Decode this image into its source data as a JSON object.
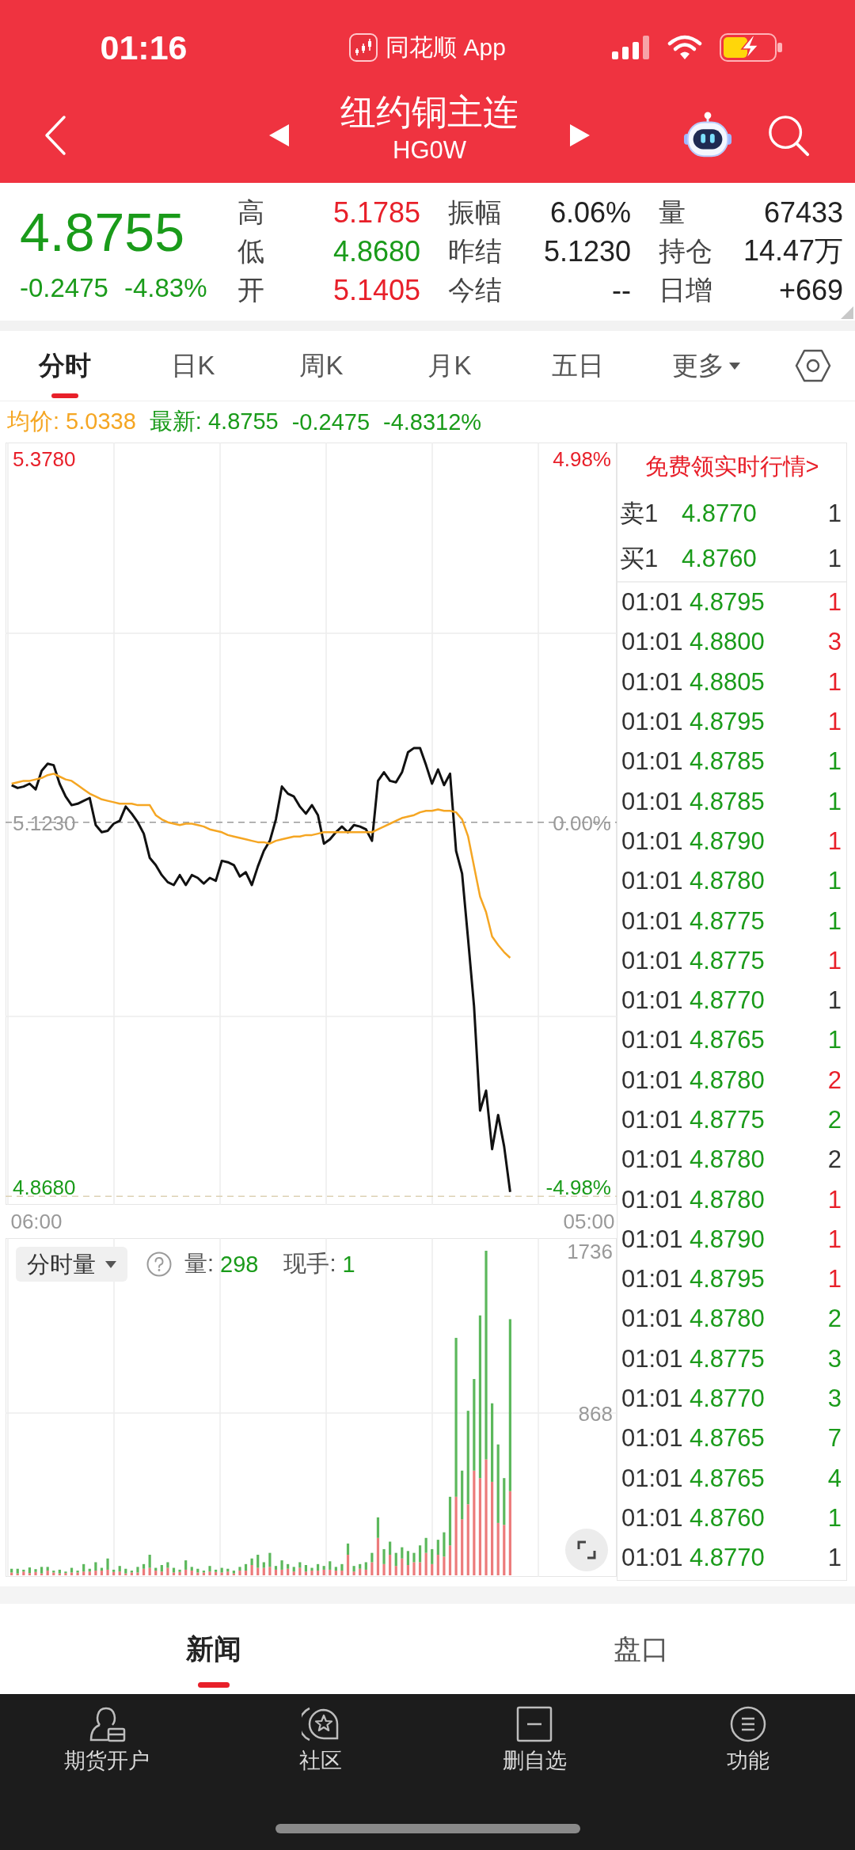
{
  "status_bar": {
    "time": "01:16",
    "app": "同花顺 App"
  },
  "header": {
    "title": "纽约铜主连",
    "code": "HG0W"
  },
  "quote": {
    "price": "4.8755",
    "change": "-0.2475",
    "change_percent": "-4.83%",
    "stats": [
      {
        "label": "高",
        "value": "5.1785",
        "color": "#e8202a"
      },
      {
        "label": "振幅",
        "value": "6.06%",
        "color": "#222222"
      },
      {
        "label": "量",
        "value": "67433",
        "color": "#222222"
      },
      {
        "label": "低",
        "value": "4.8680",
        "color": "#1a9b1a"
      },
      {
        "label": "昨结",
        "value": "5.1230",
        "color": "#222222"
      },
      {
        "label": "持仓",
        "value": "14.47万",
        "color": "#222222"
      },
      {
        "label": "开",
        "value": "5.1405",
        "color": "#e8202a"
      },
      {
        "label": "今结",
        "value": "--",
        "color": "#222222"
      },
      {
        "label": "日增",
        "value": "+669",
        "color": "#222222"
      }
    ]
  },
  "chart_tabs": [
    {
      "label": "分时",
      "selected": true,
      "kind": "tab"
    },
    {
      "label": "日K",
      "selected": false,
      "kind": "tab"
    },
    {
      "label": "周K",
      "selected": false,
      "kind": "tab"
    },
    {
      "label": "月K",
      "selected": false,
      "kind": "tab"
    },
    {
      "label": "五日",
      "selected": false,
      "kind": "tab"
    },
    {
      "label": "更多",
      "selected": false,
      "kind": "dropdown"
    }
  ],
  "info_line": {
    "average": "均价: 5.0338",
    "latest": "最新: 4.8755",
    "change": "-0.2475",
    "change_percent": "-4.8312%"
  },
  "price_chart": {
    "right_labels": [
      "4.98%",
      "0.00%",
      "-4.98%"
    ],
    "chart_data": {
      "type": "line",
      "categories": [
        null,
        null,
        null,
        null,
        "06:00",
        null,
        null,
        null,
        null,
        null,
        null,
        null,
        null,
        null,
        null,
        null,
        null,
        null,
        null,
        null,
        null,
        null,
        null,
        null,
        null,
        null,
        null,
        null,
        null,
        null,
        null,
        null,
        null,
        null,
        null,
        null,
        null,
        null,
        null,
        null,
        null,
        null,
        null,
        null,
        null,
        null,
        null,
        null,
        null,
        null,
        null,
        null,
        null,
        null,
        null,
        null,
        null,
        null,
        null,
        null,
        null,
        null,
        null,
        null,
        null,
        null,
        null,
        null,
        null,
        null,
        null,
        null,
        null,
        null,
        null,
        null,
        null,
        null,
        null,
        null,
        null,
        null,
        null,
        null,
        null,
        null,
        null,
        null,
        null,
        null,
        null,
        null,
        null,
        null,
        null,
        null,
        "05:00"
      ],
      "ylim": [
        4.855,
        5.389
      ],
      "yticks": [
        {
          "value": 5.378,
          "label": "5.3780"
        },
        {
          "value": 5.123,
          "label": "5.1230"
        },
        {
          "value": 4.868,
          "label": "4.8680"
        }
      ],
      "ref_lines": [
        {
          "axis": "y",
          "value": 5.123
        },
        {
          "axis": "y",
          "value": 4.861
        }
      ],
      "series": [
        {
          "color": "#111111",
          "values": [
            5.149,
            5.147,
            5.148,
            5.15,
            5.146,
            5.159,
            5.164,
            5.163,
            5.15,
            5.141,
            5.135,
            5.136,
            5.138,
            5.14,
            5.121,
            5.116,
            5.117,
            5.122,
            5.124,
            5.134,
            5.129,
            5.123,
            5.115,
            5.098,
            5.093,
            5.086,
            5.081,
            5.079,
            5.086,
            5.079,
            5.086,
            5.084,
            5.08,
            5.084,
            5.082,
            5.096,
            5.095,
            5.093,
            5.085,
            5.088,
            5.079,
            5.092,
            5.103,
            5.11,
            5.125,
            5.148,
            5.143,
            5.141,
            5.134,
            5.129,
            5.135,
            5.128,
            5.108,
            5.111,
            5.116,
            5.12,
            5.116,
            5.121,
            5.12,
            5.118,
            5.11,
            5.152,
            5.158,
            5.152,
            5.151,
            5.158,
            5.172,
            5.175,
            5.175,
            5.163,
            5.15,
            5.16,
            5.149,
            5.157,
            5.103,
            5.087,
            5.041,
            4.994,
            4.921,
            4.935,
            4.894,
            4.918,
            4.896,
            4.864,
            null,
            null,
            null,
            null,
            null,
            null,
            null,
            null,
            null,
            null,
            null,
            null,
            null
          ]
        },
        {
          "color": "#f5a623",
          "values": [
            5.15,
            5.151,
            5.152,
            5.152,
            5.153,
            5.154,
            5.156,
            5.157,
            5.155,
            5.153,
            5.152,
            5.149,
            5.146,
            5.143,
            5.141,
            5.139,
            5.138,
            5.137,
            5.136,
            5.136,
            5.136,
            5.135,
            5.135,
            5.135,
            5.128,
            5.125,
            5.123,
            5.122,
            5.121,
            5.122,
            5.122,
            5.121,
            5.12,
            5.118,
            5.117,
            5.116,
            5.114,
            5.113,
            5.112,
            5.111,
            5.11,
            5.109,
            5.109,
            5.108,
            5.11,
            5.111,
            5.112,
            5.113,
            5.113,
            5.114,
            5.114,
            5.115,
            5.116,
            5.116,
            5.116,
            5.116,
            5.116,
            5.116,
            5.116,
            5.116,
            5.116,
            5.118,
            5.12,
            5.122,
            5.124,
            5.126,
            5.127,
            5.128,
            5.13,
            5.131,
            5.131,
            5.132,
            5.131,
            5.131,
            5.13,
            5.125,
            5.113,
            5.092,
            5.071,
            5.06,
            5.043,
            5.037,
            5.032,
            5.028,
            null,
            null,
            null,
            null,
            null,
            null,
            null,
            null,
            null,
            null,
            null,
            null,
            null
          ]
        }
      ]
    }
  },
  "quotes_panel": {
    "promo": "免费领实时行情>",
    "book": [
      {
        "side": "卖1",
        "price": "4.8770",
        "volume": "1"
      },
      {
        "side": "买1",
        "price": "4.8760",
        "volume": "1"
      }
    ],
    "trades": [
      {
        "time": "01:01",
        "price": "4.8795",
        "volume": "1",
        "color": "#e8202a"
      },
      {
        "time": "01:01",
        "price": "4.8800",
        "volume": "3",
        "color": "#e8202a"
      },
      {
        "time": "01:01",
        "price": "4.8805",
        "volume": "1",
        "color": "#e8202a"
      },
      {
        "time": "01:01",
        "price": "4.8795",
        "volume": "1",
        "color": "#e8202a"
      },
      {
        "time": "01:01",
        "price": "4.8785",
        "volume": "1",
        "color": "#1a9b1a"
      },
      {
        "time": "01:01",
        "price": "4.8785",
        "volume": "1",
        "color": "#1a9b1a"
      },
      {
        "time": "01:01",
        "price": "4.8790",
        "volume": "1",
        "color": "#e8202a"
      },
      {
        "time": "01:01",
        "price": "4.8780",
        "volume": "1",
        "color": "#1a9b1a"
      },
      {
        "time": "01:01",
        "price": "4.8775",
        "volume": "1",
        "color": "#1a9b1a"
      },
      {
        "time": "01:01",
        "price": "4.8775",
        "volume": "1",
        "color": "#e8202a"
      },
      {
        "time": "01:01",
        "price": "4.8770",
        "volume": "1",
        "color": "#333333"
      },
      {
        "time": "01:01",
        "price": "4.8765",
        "volume": "1",
        "color": "#1a9b1a"
      },
      {
        "time": "01:01",
        "price": "4.8780",
        "volume": "2",
        "color": "#e8202a"
      },
      {
        "time": "01:01",
        "price": "4.8775",
        "volume": "2",
        "color": "#1a9b1a"
      },
      {
        "time": "01:01",
        "price": "4.8780",
        "volume": "2",
        "color": "#333333"
      },
      {
        "time": "01:01",
        "price": "4.8780",
        "volume": "1",
        "color": "#e8202a"
      },
      {
        "time": "01:01",
        "price": "4.8790",
        "volume": "1",
        "color": "#e8202a"
      },
      {
        "time": "01:01",
        "price": "4.8795",
        "volume": "1",
        "color": "#e8202a"
      },
      {
        "time": "01:01",
        "price": "4.8780",
        "volume": "2",
        "color": "#1a9b1a"
      },
      {
        "time": "01:01",
        "price": "4.8775",
        "volume": "3",
        "color": "#1a9b1a"
      },
      {
        "time": "01:01",
        "price": "4.8770",
        "volume": "3",
        "color": "#1a9b1a"
      },
      {
        "time": "01:01",
        "price": "4.8765",
        "volume": "7",
        "color": "#1a9b1a"
      },
      {
        "time": "01:01",
        "price": "4.8765",
        "volume": "4",
        "color": "#1a9b1a"
      },
      {
        "time": "01:01",
        "price": "4.8760",
        "volume": "1",
        "color": "#1a9b1a"
      },
      {
        "time": "01:01",
        "price": "4.8770",
        "volume": "1",
        "color": "#333333"
      }
    ]
  },
  "volume_chart": {
    "indicator": "分时量",
    "volume_label": "量:",
    "volume": "298",
    "hand_label": "现手:",
    "hand": "1",
    "chart_data": {
      "type": "bar",
      "stacked": true,
      "categories": [
        null,
        null,
        null,
        null,
        null,
        null,
        null,
        null,
        null,
        null,
        null,
        null,
        null,
        null,
        null,
        null,
        null,
        null,
        null,
        null,
        null,
        null,
        null,
        null,
        null,
        null,
        null,
        null,
        null,
        null,
        null,
        null,
        null,
        null,
        null,
        null,
        null,
        null,
        null,
        null,
        null,
        null,
        null,
        null,
        null,
        null,
        null,
        null,
        null,
        null,
        null,
        null,
        null,
        null,
        null,
        null,
        null,
        null,
        null,
        null,
        null,
        null,
        null,
        null,
        null,
        null,
        null,
        null,
        null,
        null,
        null,
        null,
        null,
        null,
        null,
        null,
        null,
        null,
        null,
        null,
        null,
        null,
        null,
        null,
        null,
        null,
        null,
        null,
        null,
        null,
        null,
        null,
        null,
        null,
        null,
        null,
        null
      ],
      "ylim": [
        0,
        1736
      ],
      "yticks": [
        {
          "value": 868,
          "label": "868"
        },
        {
          "value": 1736,
          "label": "1736"
        }
      ],
      "series": [
        {
          "color": "#ec7b7b",
          "values": [
            15,
            10,
            20,
            12,
            18,
            10,
            25,
            15,
            10,
            12,
            15,
            15,
            20,
            20,
            25,
            25,
            30,
            18,
            20,
            10,
            15,
            15,
            35,
            40,
            25,
            20,
            40,
            15,
            18,
            30,
            25,
            15,
            15,
            20,
            18,
            15,
            20,
            10,
            25,
            25,
            55,
            40,
            40,
            45,
            30,
            30,
            35,
            20,
            40,
            20,
            25,
            25,
            30,
            30,
            25,
            25,
            110,
            20,
            35,
            30,
            70,
            200,
            60,
            110,
            50,
            90,
            55,
            70,
            70,
            120,
            60,
            110,
            100,
            160,
            420,
            300,
            380,
            560,
            520,
            620,
            500,
            280,
            270,
            450,
            null,
            null,
            null,
            null,
            null,
            null,
            null,
            null,
            null,
            null,
            null,
            null,
            null
          ]
        },
        {
          "color": "#5cb85c",
          "values": [
            20,
            25,
            10,
            30,
            15,
            35,
            20,
            10,
            20,
            8,
            25,
            10,
            40,
            15,
            45,
            15,
            60,
            12,
            30,
            25,
            10,
            30,
            25,
            70,
            15,
            35,
            30,
            25,
            12,
            50,
            20,
            20,
            10,
            30,
            12,
            25,
            15,
            15,
            20,
            35,
            35,
            70,
            30,
            75,
            20,
            50,
            25,
            25,
            30,
            35,
            15,
            35,
            20,
            45,
            20,
            35,
            60,
            30,
            25,
            40,
            50,
            110,
            80,
            70,
            70,
            60,
            75,
            50,
            90,
            80,
            80,
            80,
            130,
            260,
            850,
            260,
            500,
            490,
            870,
            1116,
            420,
            420,
            250,
            920,
            null,
            null,
            null,
            null,
            null,
            null,
            null,
            null,
            null,
            null,
            null,
            null,
            null
          ]
        }
      ]
    }
  },
  "bottom_tabs": [
    {
      "label": "新闻",
      "selected": true
    },
    {
      "label": "盘口",
      "selected": false
    }
  ],
  "bottom_nav": [
    {
      "label": "期货开户",
      "kind": "account"
    },
    {
      "label": "社区",
      "kind": "community"
    },
    {
      "label": "删自选",
      "kind": "watchlist"
    },
    {
      "label": "功能",
      "kind": "functions"
    }
  ]
}
